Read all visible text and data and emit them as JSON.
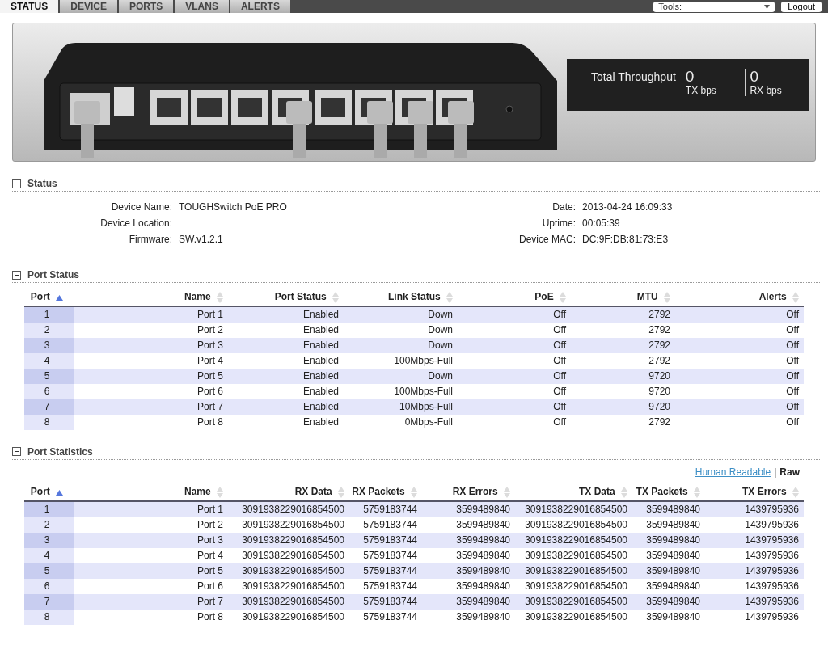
{
  "tabs": [
    {
      "label": "STATUS",
      "selected": true
    },
    {
      "label": "DEVICE",
      "selected": false
    },
    {
      "label": "PORTS",
      "selected": false
    },
    {
      "label": "VLANS",
      "selected": false
    },
    {
      "label": "ALERTS",
      "selected": false
    }
  ],
  "tools": {
    "value": "Tools:"
  },
  "logout": "Logout",
  "throughput": {
    "title": "Total Throughput",
    "tx_value": "0",
    "tx_unit": "TX bps",
    "rx_value": "0",
    "rx_unit": "RX bps"
  },
  "status": {
    "title": "Status",
    "expanded": true,
    "left": [
      {
        "label": "Device Name:",
        "value": "TOUGHSwitch PoE PRO"
      },
      {
        "label": "Device Location:"
      },
      {
        "label": "Firmware:",
        "value": "SW.v1.2.1"
      }
    ],
    "right": [
      {
        "label": "Date:",
        "value": "2013-04-24 16:09:33"
      },
      {
        "label": "Uptime:",
        "value": "00:05:39"
      },
      {
        "label": "Device MAC:",
        "value": "DC:9F:DB:81:73:E3"
      }
    ]
  },
  "port_status": {
    "title": "Port Status",
    "expanded": true,
    "columns": [
      {
        "label": "Port",
        "sorted": true
      },
      {
        "label": "Name",
        "sorted": false
      },
      {
        "label": "Port Status",
        "sorted": false
      },
      {
        "label": "Link Status",
        "sorted": false
      },
      {
        "label": "PoE",
        "sorted": false
      },
      {
        "label": "MTU",
        "sorted": false
      },
      {
        "label": "Alerts",
        "sorted": false
      }
    ],
    "rows": [
      [
        "1",
        "Port 1",
        "Enabled",
        "Down",
        "Off",
        "2792",
        "Off"
      ],
      [
        "2",
        "Port 2",
        "Enabled",
        "Down",
        "Off",
        "2792",
        "Off"
      ],
      [
        "3",
        "Port 3",
        "Enabled",
        "Down",
        "Off",
        "2792",
        "Off"
      ],
      [
        "4",
        "Port 4",
        "Enabled",
        "100Mbps-Full",
        "Off",
        "2792",
        "Off"
      ],
      [
        "5",
        "Port 5",
        "Enabled",
        "Down",
        "Off",
        "9720",
        "Off"
      ],
      [
        "6",
        "Port 6",
        "Enabled",
        "100Mbps-Full",
        "Off",
        "9720",
        "Off"
      ],
      [
        "7",
        "Port 7",
        "Enabled",
        "10Mbps-Full",
        "Off",
        "9720",
        "Off"
      ],
      [
        "8",
        "Port 8",
        "Enabled",
        "0Mbps-Full",
        "Off",
        "2792",
        "Off"
      ]
    ]
  },
  "port_statistics": {
    "title": "Port Statistics",
    "expanded": true,
    "view_modes": [
      {
        "label": "Human Readable",
        "selected": false
      },
      {
        "label": "Raw",
        "selected": true
      }
    ],
    "separator": "|",
    "columns": [
      {
        "label": "Port",
        "sorted": true
      },
      {
        "label": "Name",
        "sorted": false
      },
      {
        "label": "RX Data",
        "sorted": false
      },
      {
        "label": "RX Packets",
        "sorted": false
      },
      {
        "label": "RX Errors",
        "sorted": false
      },
      {
        "label": "TX Data",
        "sorted": false
      },
      {
        "label": "TX Packets",
        "sorted": false
      },
      {
        "label": "TX Errors",
        "sorted": false
      }
    ],
    "rows": [
      [
        "1",
        "Port 1",
        "3091938229016854500",
        "5759183744",
        "3599489840",
        "3091938229016854500",
        "3599489840",
        "1439795936"
      ],
      [
        "2",
        "Port 2",
        "3091938229016854500",
        "5759183744",
        "3599489840",
        "3091938229016854500",
        "3599489840",
        "1439795936"
      ],
      [
        "3",
        "Port 3",
        "3091938229016854500",
        "5759183744",
        "3599489840",
        "3091938229016854500",
        "3599489840",
        "1439795936"
      ],
      [
        "4",
        "Port 4",
        "3091938229016854500",
        "5759183744",
        "3599489840",
        "3091938229016854500",
        "3599489840",
        "1439795936"
      ],
      [
        "5",
        "Port 5",
        "3091938229016854500",
        "5759183744",
        "3599489840",
        "3091938229016854500",
        "3599489840",
        "1439795936"
      ],
      [
        "6",
        "Port 6",
        "3091938229016854500",
        "5759183744",
        "3599489840",
        "3091938229016854500",
        "3599489840",
        "1439795936"
      ],
      [
        "7",
        "Port 7",
        "3091938229016854500",
        "5759183744",
        "3599489840",
        "3091938229016854500",
        "3599489840",
        "1439795936"
      ],
      [
        "8",
        "Port 8",
        "3091938229016854500",
        "5759183744",
        "3599489840",
        "3091938229016854500",
        "3599489840",
        "1439795936"
      ]
    ]
  }
}
